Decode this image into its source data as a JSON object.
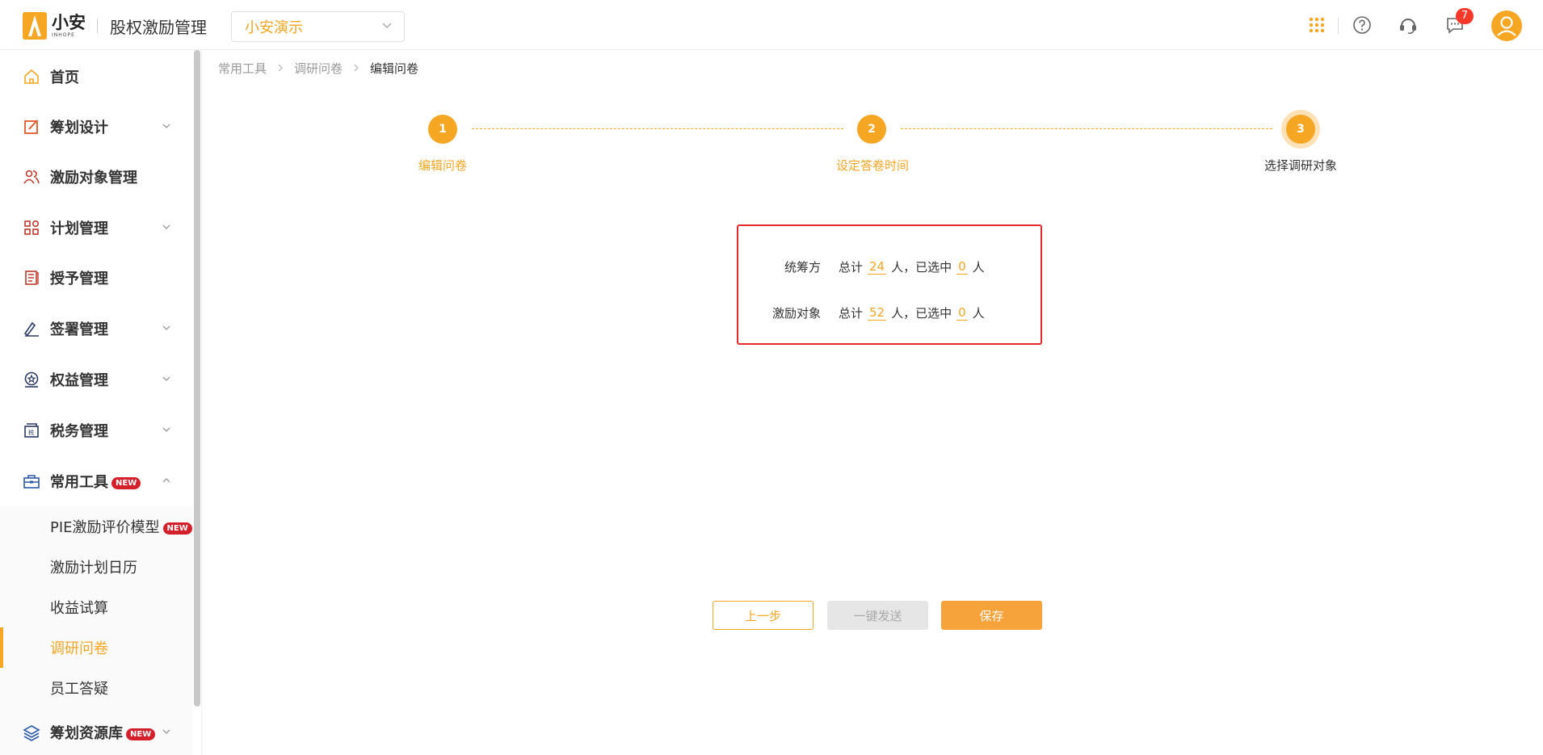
{
  "header": {
    "logo_cn": "小安",
    "logo_en": "INHOPE",
    "app_title": "股权激励管理",
    "company": "小安演示",
    "message_count": "7"
  },
  "sidebar": {
    "items": [
      {
        "label": "首页"
      },
      {
        "label": "筹划设计"
      },
      {
        "label": "激励对象管理"
      },
      {
        "label": "计划管理"
      },
      {
        "label": "授予管理"
      },
      {
        "label": "签署管理"
      },
      {
        "label": "权益管理"
      },
      {
        "label": "税务管理"
      },
      {
        "label": "常用工具",
        "tag": "NEW"
      }
    ],
    "submenu": [
      {
        "label": "PIE激励评价模型",
        "tag": "NEW"
      },
      {
        "label": "激励计划日历"
      },
      {
        "label": "收益试算"
      },
      {
        "label": "调研问卷"
      },
      {
        "label": "员工答疑"
      }
    ],
    "resource": {
      "label": "筹划资源库",
      "tag": "NEW"
    }
  },
  "breadcrumb": [
    "常用工具",
    "调研问卷",
    "编辑问卷"
  ],
  "steps": [
    {
      "num": "1",
      "label": "编辑问卷"
    },
    {
      "num": "2",
      "label": "设定答卷时间"
    },
    {
      "num": "3",
      "label": "选择调研对象"
    }
  ],
  "summary": {
    "rows": [
      {
        "label": "统筹方",
        "total_prefix": "总计",
        "total": "24",
        "mid": "人，已选中",
        "selected": "0",
        "unit": "人"
      },
      {
        "label": "激励对象",
        "total_prefix": "总计",
        "total": "52",
        "mid": "人，已选中",
        "selected": "0",
        "unit": "人"
      }
    ]
  },
  "buttons": {
    "prev": "上一步",
    "send": "一键发送",
    "save": "保存"
  },
  "colors": {
    "accent": "#f5a623",
    "highlight_border": "#e62a2a",
    "badge": "#f5382a"
  }
}
